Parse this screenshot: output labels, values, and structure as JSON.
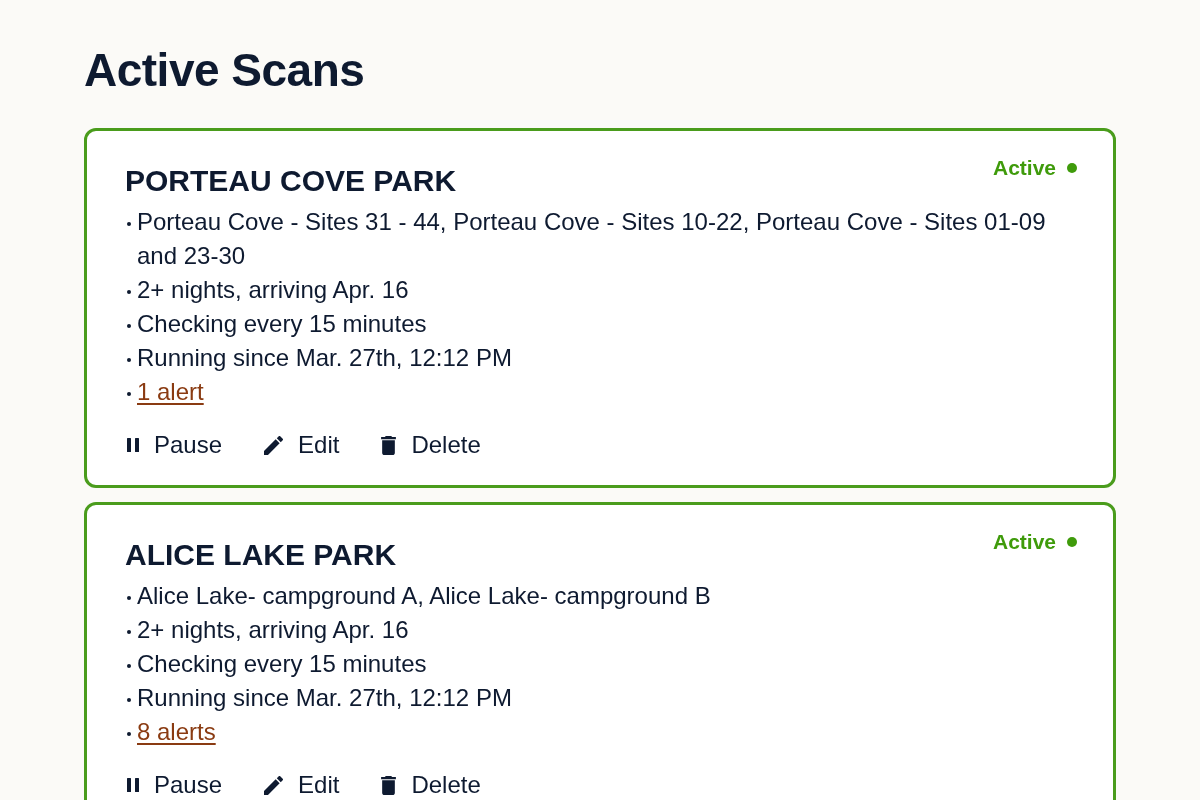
{
  "page": {
    "title": "Active Scans"
  },
  "scans": [
    {
      "name": "PORTEAU COVE PARK",
      "status": {
        "label": "Active",
        "active": true
      },
      "details": [
        {
          "kind": "text",
          "text": "Porteau Cove - Sites 31 - 44, Porteau Cove - Sites 10-22, Porteau Cove - Sites 01-09 and 23-30"
        },
        {
          "kind": "text",
          "text": "2+ nights, arriving Apr. 16"
        },
        {
          "kind": "text",
          "text": "Checking every 15 minutes"
        },
        {
          "kind": "text",
          "text": "Running since Mar. 27th, 12:12 PM"
        },
        {
          "kind": "link",
          "text": "1 alert"
        }
      ],
      "actions": [
        {
          "kind": "pause",
          "label": "Pause"
        },
        {
          "kind": "edit",
          "label": "Edit"
        },
        {
          "kind": "delete",
          "label": "Delete"
        }
      ]
    },
    {
      "name": "ALICE LAKE PARK",
      "status": {
        "label": "Active",
        "active": true
      },
      "details": [
        {
          "kind": "text",
          "text": "Alice Lake- campground A, Alice Lake- campground B"
        },
        {
          "kind": "text",
          "text": "2+ nights, arriving Apr. 16"
        },
        {
          "kind": "text",
          "text": "Checking every 15 minutes"
        },
        {
          "kind": "text",
          "text": "Running since Mar. 27th, 12:12 PM"
        },
        {
          "kind": "link",
          "text": "8 alerts"
        }
      ],
      "actions": [
        {
          "kind": "pause",
          "label": "Pause"
        },
        {
          "kind": "edit",
          "label": "Edit"
        },
        {
          "kind": "delete",
          "label": "Delete"
        }
      ]
    }
  ]
}
